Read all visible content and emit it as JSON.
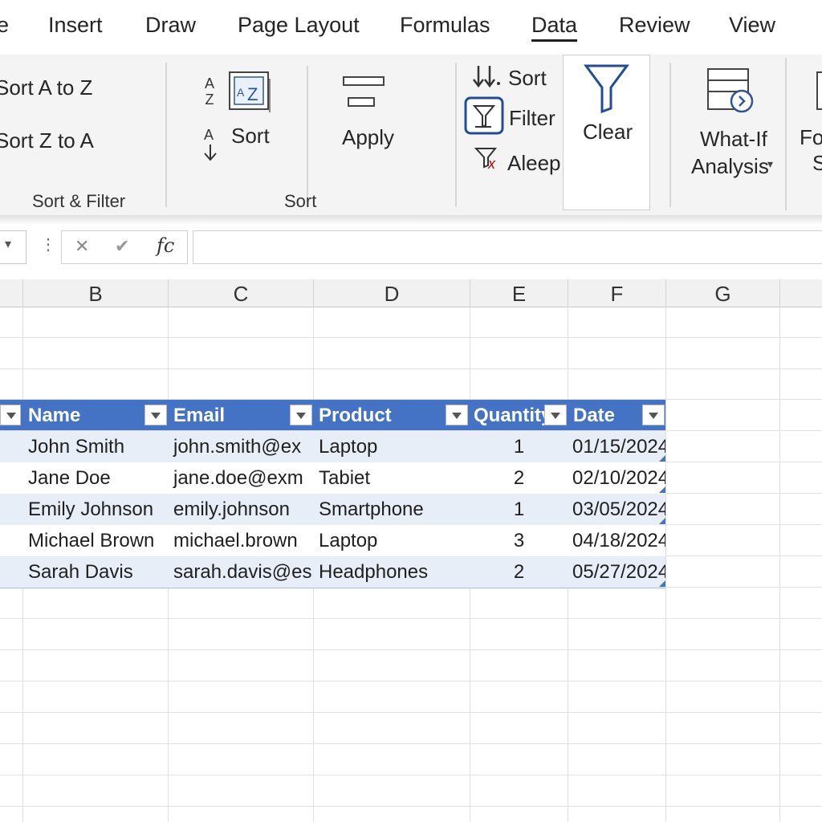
{
  "tabs": [
    "e",
    "Insert",
    "Draw",
    "Page Layout",
    "Formulas",
    "Data",
    "Review",
    "View"
  ],
  "active_tab": "Data",
  "ribbon": {
    "sort_az": "Sort A to Z",
    "sort_za": "Sort Z to A",
    "group1_label": "Sort & Filter",
    "sort_az_icon_a": "A",
    "sort_az_icon_z": "Z",
    "sort_btn": "Sort",
    "sort_small_a": "A",
    "apply_label": "Apply",
    "group2_label": "Sort",
    "sort_small": "Sort",
    "filter_small": "Filter",
    "aleep_small": "Aleep",
    "clear_label": "Clear",
    "whatif_line1": "What-If",
    "whatif_line2": "Analysis",
    "fo_line1": "Fo",
    "fo_line2": "S"
  },
  "formula_bar": {
    "cancel": "✕",
    "enter": "✔",
    "fx": "fc",
    "value": ""
  },
  "columns": [
    "B",
    "C",
    "D",
    "E",
    "F",
    "G"
  ],
  "table": {
    "headers": [
      "Name",
      "Email",
      "Product",
      "Quantity",
      "Date"
    ],
    "rows": [
      [
        "John Smith",
        "john.smith@ex",
        "Laptop",
        "1",
        "01/15/2024"
      ],
      [
        "Jane Doe",
        "jane.doe@exm",
        "Tabiet",
        "2",
        "02/10/2024"
      ],
      [
        "Emily Johnson",
        "emily.johnson",
        "Smartphone",
        "1",
        "03/05/2024"
      ],
      [
        "Michael Brown",
        "michael.brown",
        "Laptop",
        "3",
        "04/18/2024"
      ],
      [
        "Sarah Davis",
        "sarah.davis@es",
        "Headphones",
        "2",
        "05/27/2024"
      ]
    ]
  },
  "colors": {
    "table_header": "#4472c4",
    "band": "#e8eef8",
    "ribbon": "#f4f4f4"
  }
}
